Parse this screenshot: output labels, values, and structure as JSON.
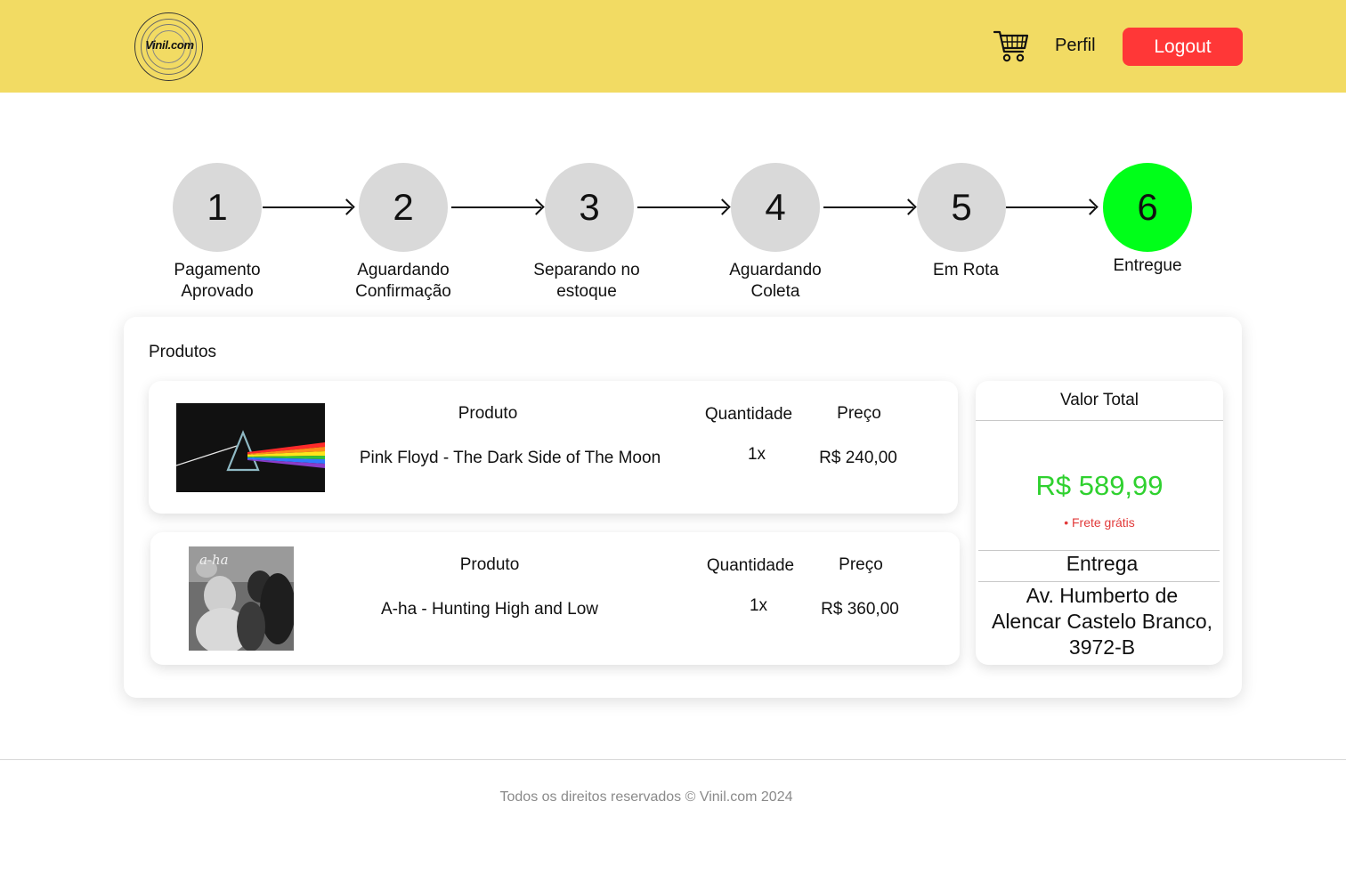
{
  "header": {
    "logo_text": "Vinil.com",
    "cart_icon": "shopping-cart-icon",
    "perfil_label": "Perfil",
    "logout_label": "Logout",
    "background_color": "#f2db63",
    "logout_color": "#ff3737"
  },
  "steps": [
    {
      "number": "1",
      "label_line1": "Pagamento",
      "label_line2": "Aprovado",
      "active": false
    },
    {
      "number": "2",
      "label_line1": "Aguardando",
      "label_line2": "Confirmação",
      "active": false
    },
    {
      "number": "3",
      "label_line1": "Separando no",
      "label_line2": "estoque",
      "active": false
    },
    {
      "number": "4",
      "label_line1": "Aguardando",
      "label_line2": "Coleta",
      "active": false
    },
    {
      "number": "5",
      "label_line1": "Em Rota",
      "label_line2": "",
      "active": false
    },
    {
      "number": "6",
      "label_line1": "Entregue",
      "label_line2": "",
      "active": true
    }
  ],
  "step_colors": {
    "inactive": "#d9d9d9",
    "active": "#00ff19"
  },
  "order": {
    "section_title": "Produtos",
    "products": [
      {
        "head_product": "Produto",
        "head_quantity": "Quantidade",
        "head_price": "Preço",
        "name": "Pink Floyd - The Dark Side of The Moon",
        "quantity": "1x",
        "price": "R$ 240,00"
      },
      {
        "head_product": "Produto",
        "head_quantity": "Quantidade",
        "head_price": "Preço",
        "name": "A-ha - Hunting High and Low",
        "quantity": "1x",
        "price": "R$ 360,00"
      }
    ],
    "summary": {
      "title": "Valor Total",
      "total": "R$ 589,99",
      "shipping": "Frete grátis",
      "delivery_title": "Entrega",
      "address_line1": "Av. Humberto de",
      "address_line2": "Alencar Castelo Branco,",
      "address_line3": "3972-B",
      "total_color": "#2fd12f",
      "shipping_color": "#e23a3a"
    }
  },
  "footer": {
    "text": "Todos os direitos reservados © Vinil.com 2024"
  }
}
